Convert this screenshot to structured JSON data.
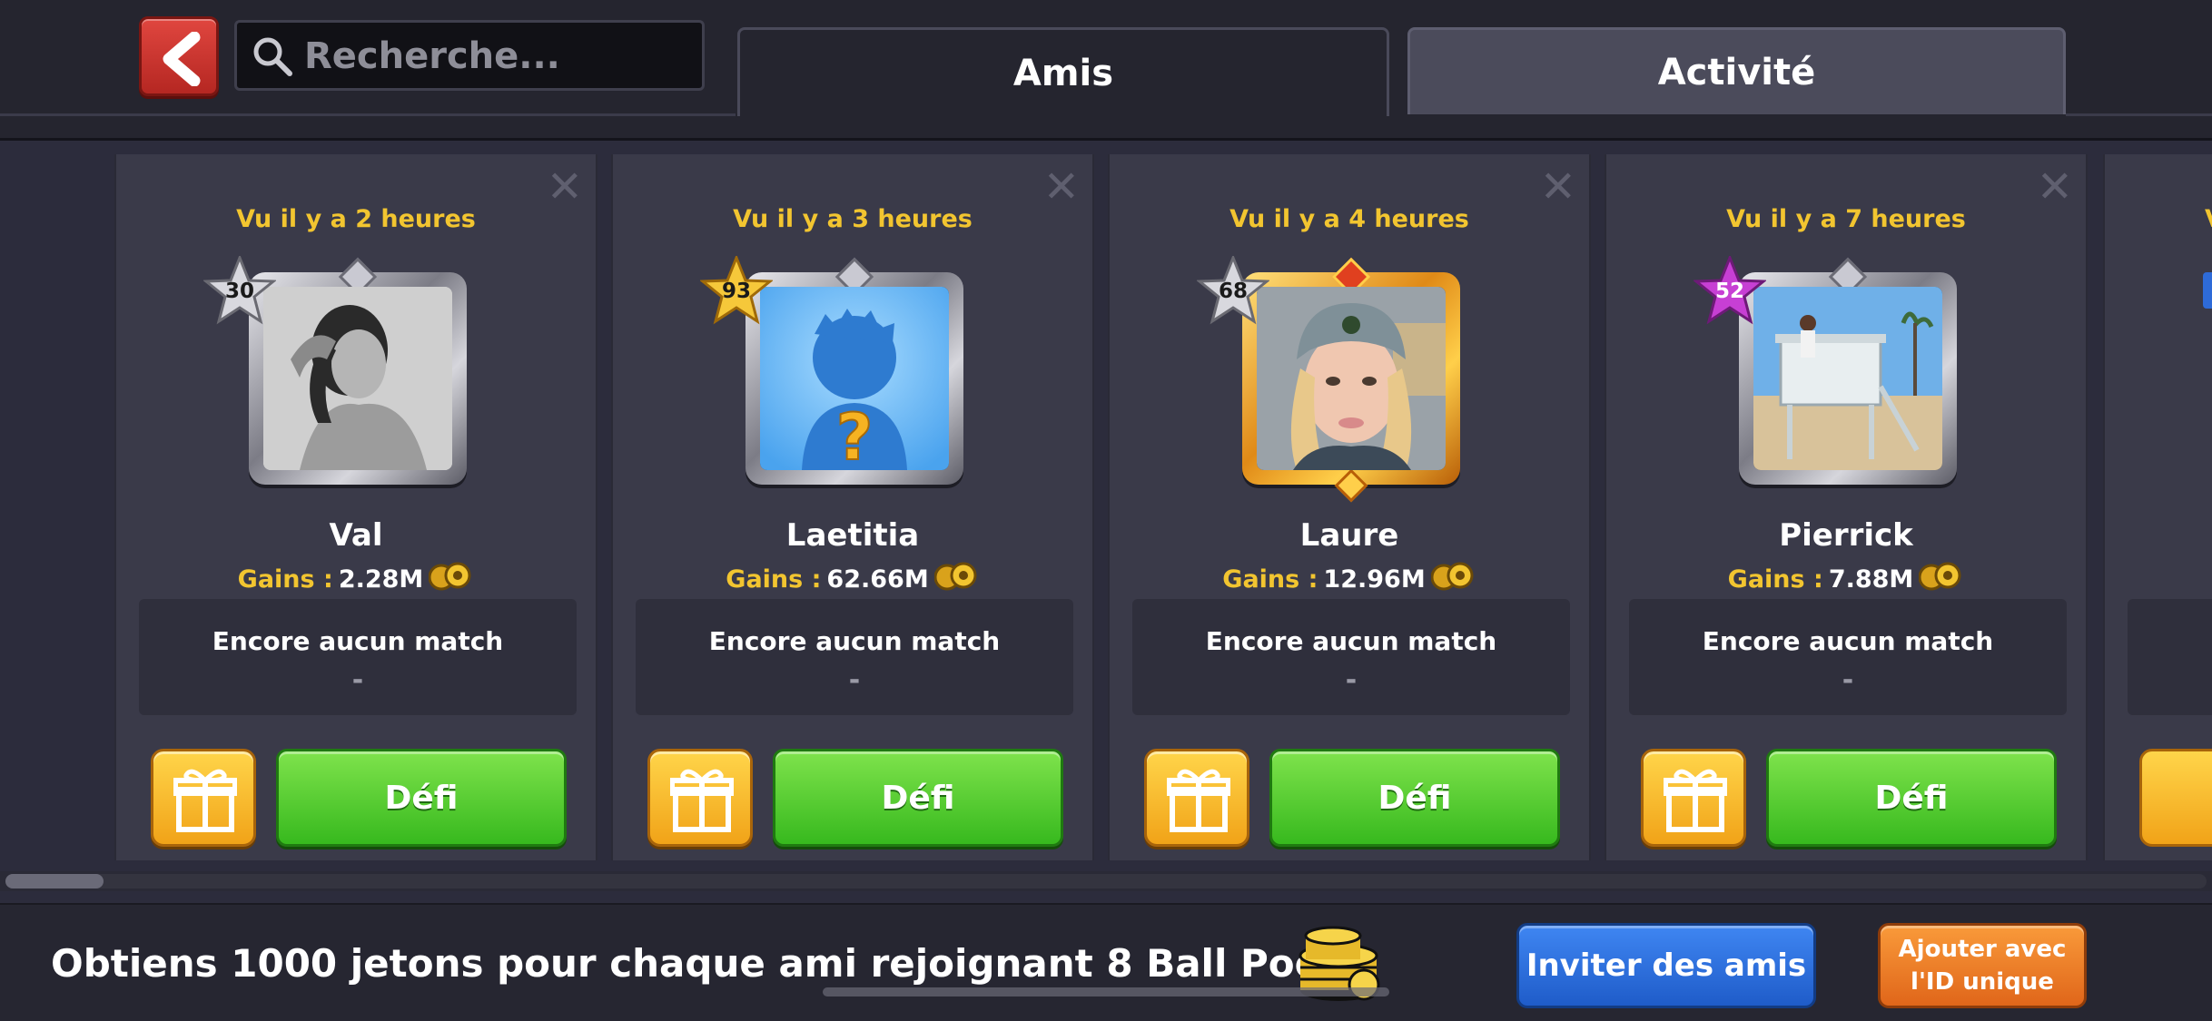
{
  "header": {
    "search_placeholder": "Recherche...",
    "tabs": [
      {
        "label": "Amis",
        "active": true
      },
      {
        "label": "Activité",
        "active": false
      }
    ]
  },
  "friends": [
    {
      "seen": "Vu il y a 2 heures",
      "level": "30",
      "level_color": "silver",
      "name": "Val",
      "gains_label": "Gains :",
      "gains_value": "2.28M",
      "match_title": "Encore aucun match",
      "match_detail": "-",
      "gift_icon": "gift-icon",
      "challenge_label": "Défi",
      "avatar": "photo-woman-bw",
      "frame": "silver"
    },
    {
      "seen": "Vu il y a 3 heures",
      "level": "93",
      "level_color": "gold",
      "name": "Laetitia",
      "gains_label": "Gains :",
      "gains_value": "62.66M",
      "match_title": "Encore aucun match",
      "match_detail": "-",
      "gift_icon": "gift-icon",
      "challenge_label": "Défi",
      "avatar": "default-silhouette",
      "frame": "silver"
    },
    {
      "seen": "Vu il y a 4 heures",
      "level": "68",
      "level_color": "silver",
      "name": "Laure",
      "gains_label": "Gains :",
      "gains_value": "12.96M",
      "match_title": "Encore aucun match",
      "match_detail": "-",
      "gift_icon": "gift-icon",
      "challenge_label": "Défi",
      "avatar": "photo-selfie",
      "frame": "gold"
    },
    {
      "seen": "Vu il y a 7 heures",
      "level": "52",
      "level_color": "purple",
      "name": "Pierrick",
      "gains_label": "Gains :",
      "gains_value": "7.88M",
      "match_title": "Encore aucun match",
      "match_detail": "-",
      "gift_icon": "gift-icon",
      "challenge_label": "Défi",
      "avatar": "photo-beach-tower",
      "frame": "silver"
    }
  ],
  "partial_card": {
    "seen_fragment": "V"
  },
  "bottom": {
    "promo": "Obtiens 1000 jetons pour chaque ami rejoignant 8 Ball Pool !",
    "invite_label": "Inviter des amis",
    "unique_id_label": "Ajouter avec\nl'ID unique"
  },
  "colors": {
    "accent_yellow": "#f2c530",
    "challenge_green": "#37b91e",
    "invite_blue": "#1f5cc9",
    "unique_orange": "#e0661a",
    "back_red": "#c0302a"
  }
}
